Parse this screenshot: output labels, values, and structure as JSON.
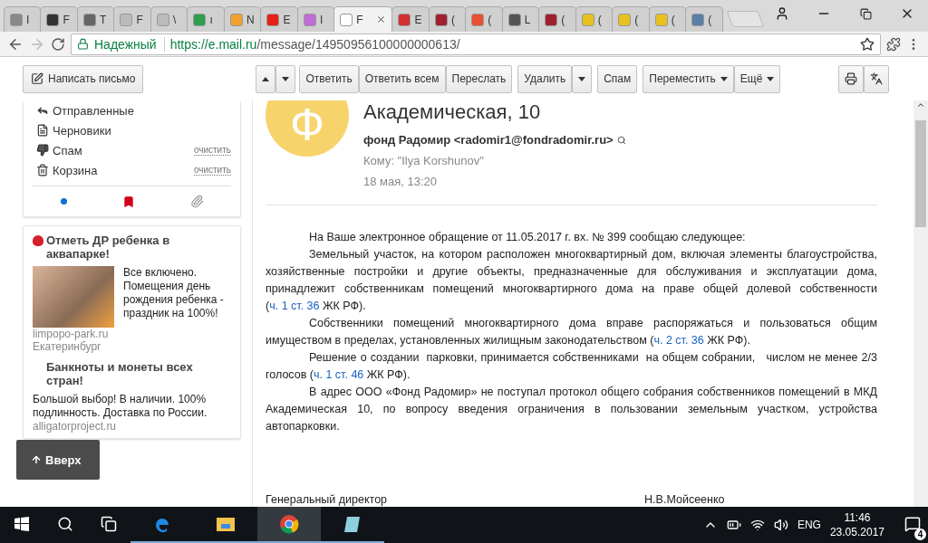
{
  "browser": {
    "tabs": [
      {
        "label": "I",
        "selected": false,
        "color": "#888888"
      },
      {
        "label": "F",
        "selected": false,
        "color": "#333333"
      },
      {
        "label": "T",
        "selected": false,
        "color": "#666666"
      },
      {
        "label": "F",
        "selected": false,
        "color": "#bbbbbb"
      },
      {
        "label": "\\",
        "selected": false,
        "color": "#bbbbbb"
      },
      {
        "label": "ı",
        "selected": false,
        "color": "#2e9e4f"
      },
      {
        "label": "N",
        "selected": false,
        "color": "#f0a030"
      },
      {
        "label": "E",
        "selected": false,
        "color": "#e62117"
      },
      {
        "label": "I",
        "selected": false,
        "color": "#c06bd6"
      },
      {
        "label": "F",
        "selected": true,
        "color": "#ffffff"
      },
      {
        "label": "E",
        "selected": false,
        "color": "#d32f2f"
      },
      {
        "label": "(",
        "selected": false,
        "color": "#a02030"
      },
      {
        "label": "(",
        "selected": false,
        "color": "#e85030"
      },
      {
        "label": "L",
        "selected": false,
        "color": "#555555"
      },
      {
        "label": "(",
        "selected": false,
        "color": "#a02030"
      },
      {
        "label": "(",
        "selected": false,
        "color": "#e8c020"
      },
      {
        "label": "(",
        "selected": false,
        "color": "#e8c020"
      },
      {
        "label": "(",
        "selected": false,
        "color": "#e8c020"
      },
      {
        "label": "(",
        "selected": false,
        "color": "#5b7fa6"
      }
    ],
    "security": "Надежный",
    "url_host": "https://e.mail.ru",
    "url_path": "/message/14950956100000000613/"
  },
  "toolbar": {
    "compose": "Написать письмо",
    "actions": [
      {
        "label": "Ответить",
        "kind": "plain"
      },
      {
        "label": "Ответить всем",
        "kind": "plain"
      },
      {
        "label": "Переслать",
        "kind": "plain"
      },
      {
        "label": "Удалить",
        "kind": "split"
      },
      {
        "label": "Спам",
        "kind": "plain"
      },
      {
        "label": "Переместить",
        "kind": "menu"
      },
      {
        "label": "Ещё",
        "kind": "menu"
      }
    ]
  },
  "sidebar": {
    "folders": [
      {
        "label": "Отправленные",
        "kind": "sent"
      },
      {
        "label": "Черновики",
        "kind": "drafts"
      },
      {
        "label": "Спам",
        "kind": "spam",
        "action": "очистить"
      },
      {
        "label": "Корзина",
        "kind": "trash",
        "action": "очистить"
      }
    ],
    "ads": [
      {
        "title": "Отметь ДР ребенка в аквапарке!",
        "text": "Все включено. Помещения день рождения ребенка - праздник на 100%!",
        "site": "limpopo-park.ru",
        "city": "Екатеринбург"
      },
      {
        "title": "Банкноты и монеты всех стран!",
        "text": "Большой выбор! В наличии. 100% подлинность. Доставка по России.",
        "site": "alligatorproject.ru"
      }
    ],
    "up_button": "Вверх"
  },
  "message": {
    "avatar_letter": "Ф",
    "subject": "Академическая, 10",
    "from": "фонд Радомир <radomir1@fondradomir.ru>",
    "to": "Кому: \"Ilya Korshunov\"",
    "date": "18 мая, 13:20",
    "paragraphs": [
      [
        {
          "kind": "text",
          "text": "На Ваше электронное обращение от 11.05.2017 г. вх. № 399 сообщаю следующее:"
        }
      ],
      [
        {
          "kind": "text",
          "text": "Земельный участок, на котором расположен многоквартирный дом, включая элементы благоустройства, хозяйственные постройки и другие объекты, предназначенные для обслуживания и эксплуатации дома, принадлежит собственникам помещений многоквартирного дома на праве общей долевой собственности ("
        },
        {
          "kind": "link",
          "text": "ч. 1 ст. 36"
        },
        {
          "kind": "text",
          "text": " ЖК РФ)."
        }
      ],
      [
        {
          "kind": "text",
          "text": "Собственники помещений многоквартирного дома вправе распоряжаться и пользоваться общим имуществом в пределах, установленных жилищным законодательством ("
        },
        {
          "kind": "link",
          "text": "ч. 2 ст. 36"
        },
        {
          "kind": "text",
          "text": " ЖК РФ)."
        }
      ],
      [
        {
          "kind": "text",
          "text": "Решение о создании  парковки, принимается собственниками  на общем собрании,   числом не менее 2/3 голосов ("
        },
        {
          "kind": "link",
          "text": "ч. 1 ст. 46"
        },
        {
          "kind": "text",
          "text": " ЖК РФ)."
        }
      ],
      [
        {
          "kind": "text",
          "text": "В адрес ООО «Фонд Радомир» не поступал протокол общего собрания собственников помещений в МКД Академическая 10, по вопросу введения ограничения в пользовании земельным участком, устройства автопарковки."
        }
      ]
    ],
    "signature_title": "Генеральный директор",
    "signature_name": "Н.В.Мойсеенко"
  },
  "taskbar": {
    "apps": [
      {
        "kind": "edge",
        "selected": false
      },
      {
        "kind": "explorer",
        "selected": false
      },
      {
        "kind": "chrome",
        "selected": true
      },
      {
        "kind": "notes",
        "selected": false
      }
    ],
    "language": "ENG",
    "time": "11:46",
    "date": "23.05.2017",
    "notifications": "4"
  }
}
